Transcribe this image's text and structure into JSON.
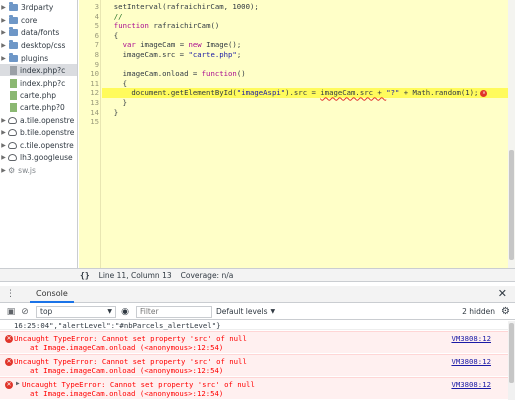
{
  "file_tree": {
    "items": [
      {
        "label": "3rdparty",
        "type": "folder",
        "icon": "folder-icon"
      },
      {
        "label": "core",
        "type": "folder",
        "icon": "folder-icon"
      },
      {
        "label": "data/fonts",
        "type": "folder",
        "icon": "folder-icon"
      },
      {
        "label": "desktop/css",
        "type": "folder",
        "icon": "folder-icon"
      },
      {
        "label": "plugins",
        "type": "folder",
        "icon": "folder-icon"
      },
      {
        "label": "index.php?c",
        "type": "file",
        "icon": "file-icon",
        "selected": true
      },
      {
        "label": "index.php?c",
        "type": "file",
        "icon": "file-icon"
      },
      {
        "label": "carte.php",
        "type": "file",
        "icon": "file-icon"
      },
      {
        "label": "carte.php?0",
        "type": "file",
        "icon": "file-icon"
      },
      {
        "label": "a.tile.openstre",
        "type": "domain",
        "icon": "cloud-icon"
      },
      {
        "label": "b.tile.openstre",
        "type": "domain",
        "icon": "cloud-icon"
      },
      {
        "label": "c.tile.openstre",
        "type": "domain",
        "icon": "cloud-icon"
      },
      {
        "label": "lh3.googleuse",
        "type": "domain",
        "icon": "cloud-icon"
      },
      {
        "label": "sw.js",
        "type": "worker",
        "icon": "gear-icon"
      }
    ]
  },
  "editor": {
    "lines": [
      {
        "n": "3",
        "text": "  setInterval(rafraichirCam, 1000);"
      },
      {
        "n": "4",
        "text": "  //"
      },
      {
        "n": "5",
        "text": "  function rafraichirCam()"
      },
      {
        "n": "6",
        "text": "  {"
      },
      {
        "n": "7",
        "text": "    var imageCam = new Image();"
      },
      {
        "n": "8",
        "text": "    imageCam.src = \"carte.php\";"
      },
      {
        "n": "9",
        "text": ""
      },
      {
        "n": "10",
        "text": "    imageCam.onload = function()"
      },
      {
        "n": "11",
        "text": "    {"
      },
      {
        "n": "12",
        "text": "      document.getElementById(\"imageAspi\").src = imageCam.src + \"?\" + Math.random(1);"
      },
      {
        "n": "13",
        "text": "    }"
      },
      {
        "n": "14",
        "text": "  }"
      },
      {
        "n": "15",
        "text": ""
      }
    ],
    "highlight_line": "12"
  },
  "status_bar": {
    "brace": "{}",
    "position": "Line 11, Column 13",
    "coverage": "Coverage: n/a"
  },
  "drawer": {
    "menu_dots": "⋮",
    "tab": "Console",
    "close": "✕"
  },
  "console_toolbar": {
    "context": "top",
    "filter_placeholder": "Filter",
    "levels": "Default levels",
    "hidden": "2 hidden"
  },
  "console_messages": {
    "info": "16:25:04\",\"alertLevel\":\"#nbParcels_alertLevel\"}",
    "errors": [
      {
        "line1": "Uncaught TypeError: Cannot set property 'src' of null",
        "line2": "at Image.imageCam.onload (<anonymous>:12:54)",
        "source": "VM3808:12",
        "expandable": false
      },
      {
        "line1": "Uncaught TypeError: Cannot set property 'src' of null",
        "line2": "at Image.imageCam.onload (<anonymous>:12:54)",
        "source": "VM3808:12",
        "expandable": false
      },
      {
        "line1": "Uncaught TypeError: Cannot set property 'src' of null",
        "line2": "at Image.imageCam.onload (<anonymous>:12:54)",
        "source": "VM3808:12",
        "expandable": true
      }
    ]
  },
  "colors": {
    "editor_bg": "#ffffc8",
    "highlight_bg": "#fffb5c",
    "error_red": "#e0352b",
    "error_bg": "#fff0f0",
    "link_blue": "#1a1aa6",
    "accent": "#1a73e8"
  }
}
